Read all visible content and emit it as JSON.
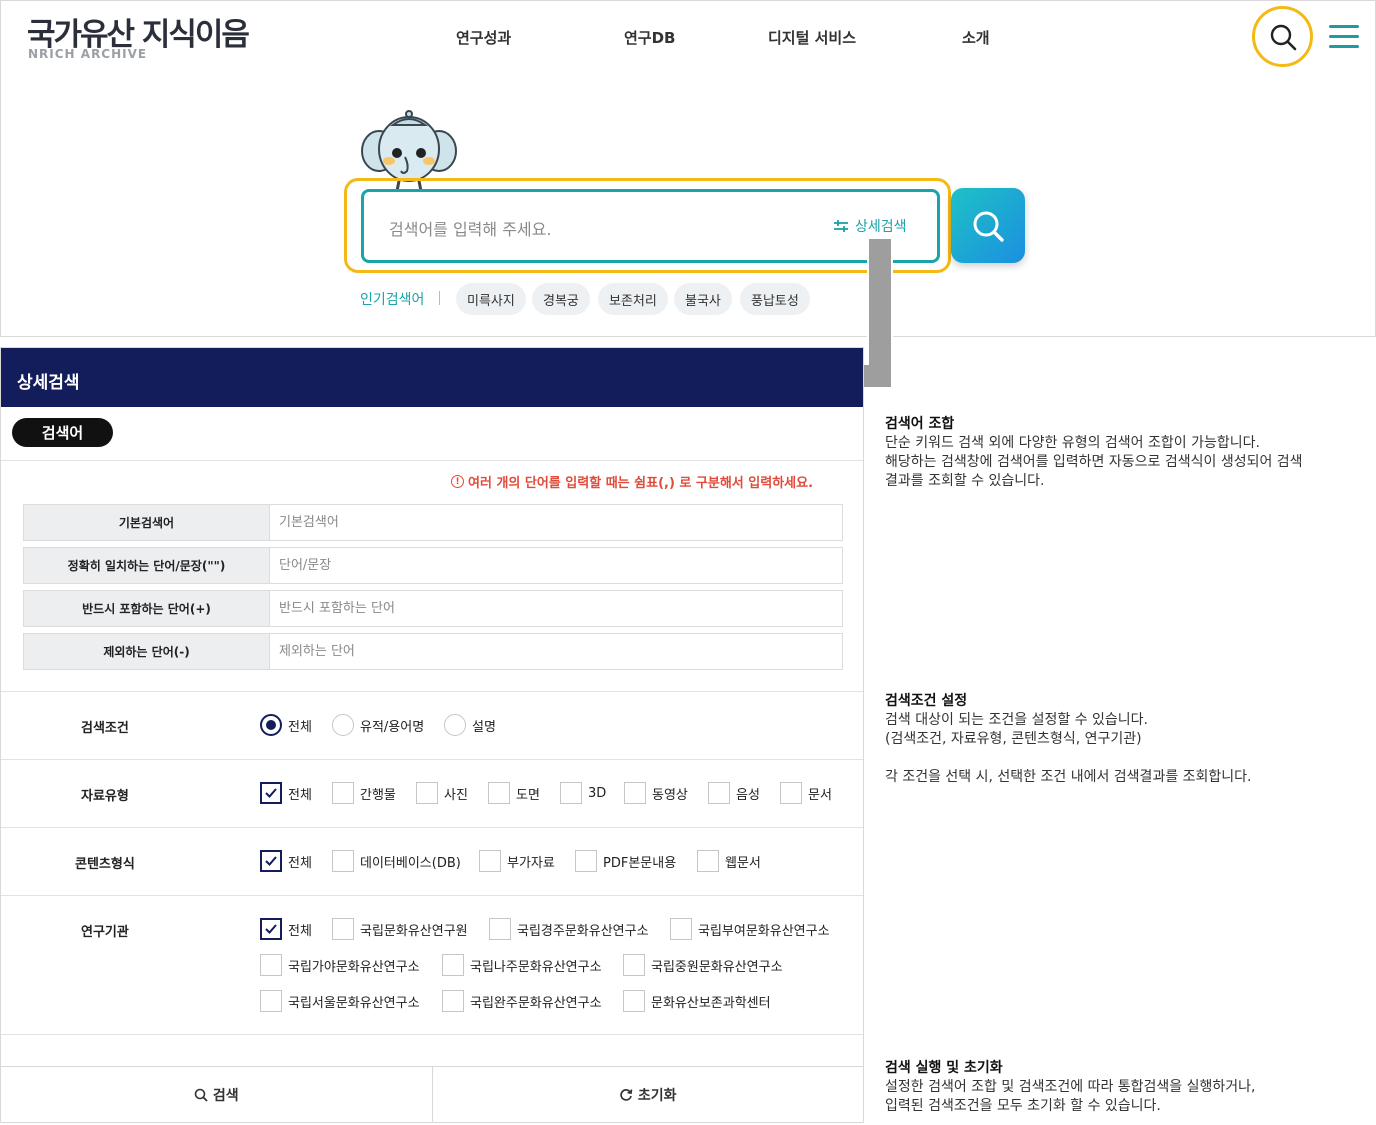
{
  "header": {
    "logo_title": "국가유산 지식이음",
    "logo_sub": "NRICH ARCHIVE",
    "nav": [
      "연구성과",
      "연구DB",
      "디지털 서비스",
      "소개"
    ]
  },
  "search": {
    "placeholder": "검색어를 입력해 주세요.",
    "advanced_link": "상세검색",
    "popular_label": "인기검색어",
    "popular": [
      "미륵사지",
      "경복궁",
      "보존처리",
      "불국사",
      "풍납토성"
    ]
  },
  "advanced": {
    "title": "상세검색",
    "section_pill": "검색어",
    "notice": "여러 개의 단어를 입력할 때는 쉼표(,) 로 구분해서 입력하세요.",
    "keyword_rows": [
      {
        "label": "기본검색어",
        "placeholder": "기본검색어"
      },
      {
        "label": "정확히 일치하는 단어/문장(\"\")",
        "placeholder": "단어/문장"
      },
      {
        "label": "반드시 포함하는 단어(+)",
        "placeholder": "반드시 포함하는 단어"
      },
      {
        "label": "제외하는 단어(-)",
        "placeholder": "제외하는 단어"
      }
    ],
    "condition": {
      "label": "검색조건",
      "options": [
        "전체",
        "유적/용어명",
        "설명"
      ]
    },
    "material": {
      "label": "자료유형",
      "options": [
        "전체",
        "간행물",
        "사진",
        "도면",
        "3D",
        "동영상",
        "음성",
        "문서"
      ]
    },
    "content": {
      "label": "콘텐츠형식",
      "options": [
        "전체",
        "데이터베이스(DB)",
        "부가자료",
        "PDF본문내용",
        "웹문서"
      ]
    },
    "institute": {
      "label": "연구기관",
      "options": [
        "전체",
        "국립문화유산연구원",
        "국립경주문화유산연구소",
        "국립부여문화유산연구소",
        "국립가야문화유산연구소",
        "국립나주문화유산연구소",
        "국립중원문화유산연구소",
        "국립서울문화유산연구소",
        "국립완주문화유산연구소",
        "문화유산보존과학센터"
      ]
    },
    "search_button": "검색",
    "reset_button": "초기화"
  },
  "notes": [
    {
      "title": "검색어 조합",
      "lines": [
        "단순 키워드 검색 외에 다양한 유형의 검색어 조합이 가능합니다.",
        "해당하는 검색창에 검색어를 입력하면 자동으로 검색식이 생성되어 검색",
        "결과를 조회할 수 있습니다."
      ]
    },
    {
      "title": "검색조건 설정",
      "lines": [
        "검색 대상이 되는 조건을 설정할 수 있습니다.",
        "(검색조건, 자료유형, 콘텐츠형식, 연구기관)",
        "",
        "각 조건을 선택 시, 선택한 조건 내에서 검색결과를 조회합니다."
      ]
    },
    {
      "title": "검색 실행 및 초기화",
      "lines": [
        "설정한 검색어 조합 및 검색조건에 따라 통합검색을 실행하거나,",
        "입력된 검색조건을 모두 초기화 할 수 있습니다."
      ]
    }
  ],
  "colors": {
    "accent": "#1aa3a8",
    "highlight": "#f5b915",
    "navy": "#141d5c",
    "notice": "#e04b3a"
  }
}
